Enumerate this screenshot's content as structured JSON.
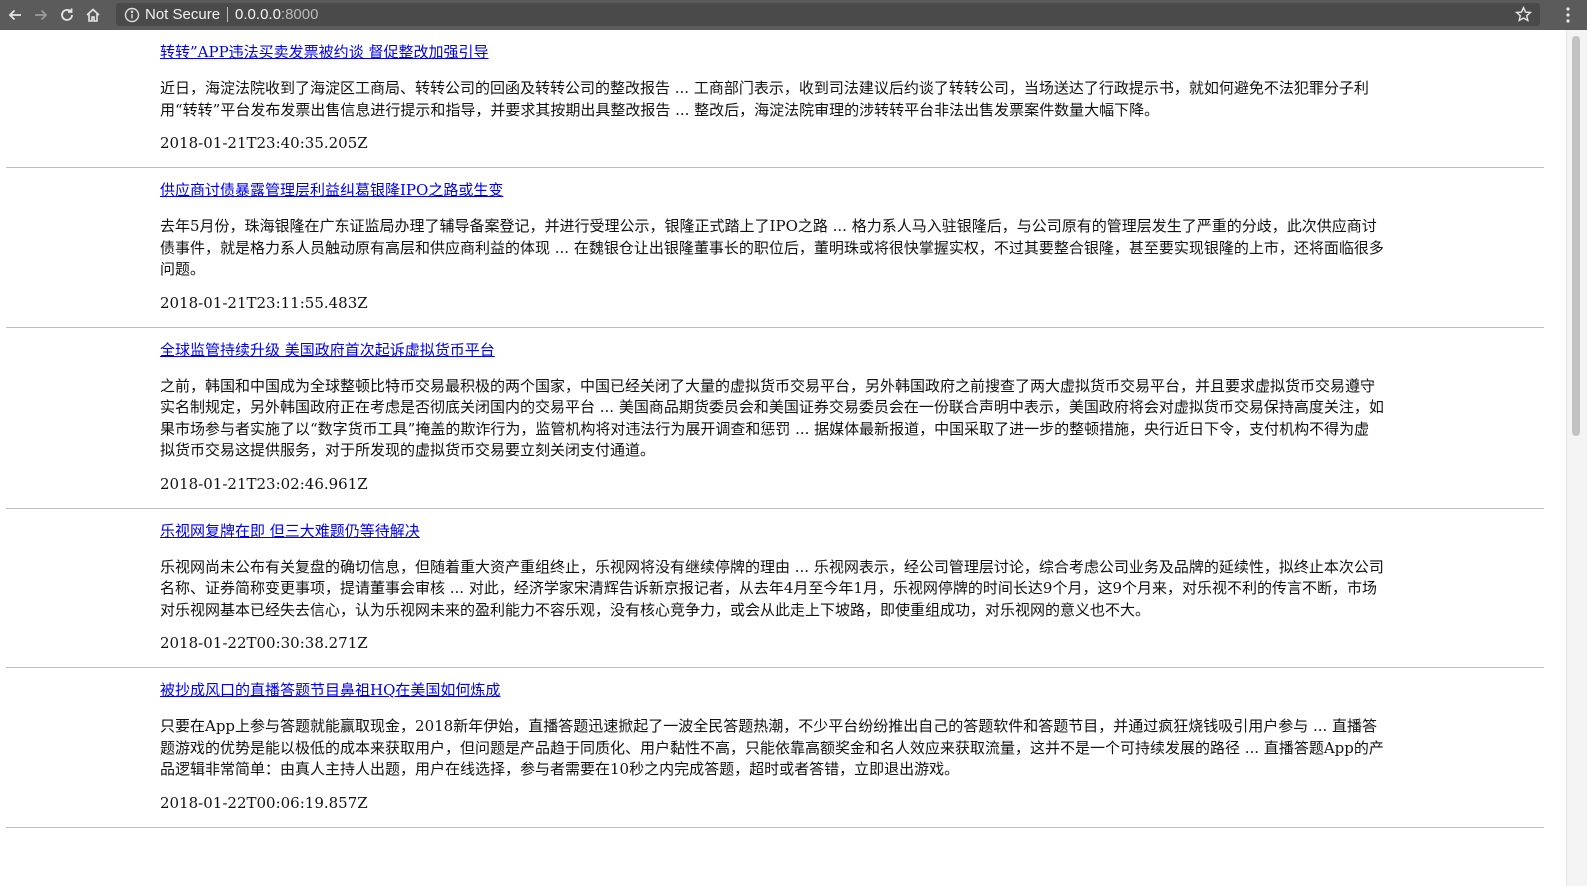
{
  "browser": {
    "security_label": "Not Secure",
    "url_host": "0.0.0.0",
    "url_port": ":8000",
    "icons": {
      "back": "back-arrow-icon",
      "forward": "forward-arrow-icon",
      "reload": "reload-icon",
      "home": "home-icon",
      "info": "info-icon",
      "star": "star-icon",
      "menu": "kebab-menu-icon"
    }
  },
  "articles": [
    {
      "title": "转转”APP违法买卖发票被约谈 督促整改加强引导",
      "summary": "近日，海淀法院收到了海淀区工商局、转转公司的回函及转转公司的整改报告 ... 工商部门表示，收到司法建议后约谈了转转公司，当场送达了行政提示书，就如何避免不法犯罪分子利用“转转”平台发布发票出售信息进行提示和指导，并要求其按期出具整改报告 ... 整改后，海淀法院审理的涉转转平台非法出售发票案件数量大幅下降。",
      "date": "2018-01-21T23:40:35.205Z"
    },
    {
      "title": "供应商讨债暴露管理层利益纠葛银隆IPO之路或生变",
      "summary": "去年5月份，珠海银隆在广东证监局办理了辅导备案登记，并进行受理公示，银隆正式踏上了IPO之路 ... 格力系人马入驻银隆后，与公司原有的管理层发生了严重的分歧，此次供应商讨债事件，就是格力系人员触动原有高层和供应商利益的体现 ... 在魏银仓让出银隆董事长的职位后，董明珠或将很快掌握实权，不过其要整合银隆，甚至要实现银隆的上市，还将面临很多问题。",
      "date": "2018-01-21T23:11:55.483Z"
    },
    {
      "title": "全球监管持续升级 美国政府首次起诉虚拟货币平台",
      "summary": "之前，韩国和中国成为全球整顿比特币交易最积极的两个国家，中国已经关闭了大量的虚拟货币交易平台，另外韩国政府之前搜查了两大虚拟货币交易平台，并且要求虚拟货币交易遵守实名制规定，另外韩国政府正在考虑是否彻底关闭国内的交易平台 ... 美国商品期货委员会和美国证券交易委员会在一份联合声明中表示，美国政府将会对虚拟货币交易保持高度关注，如果市场参与者实施了以“数字货币工具”掩盖的欺诈行为，监管机构将对违法行为展开调查和惩罚 ... 据媒体最新报道，中国采取了进一步的整顿措施，央行近日下令，支付机构不得为虚拟货币交易这提供服务，对于所发现的虚拟货币交易要立刻关闭支付通道。",
      "date": "2018-01-21T23:02:46.961Z"
    },
    {
      "title": "乐视网复牌在即 但三大难题仍等待解决",
      "summary": "乐视网尚未公布有关复盘的确切信息，但随着重大资产重组终止，乐视网将没有继续停牌的理由 ... 乐视网表示，经公司管理层讨论，综合考虑公司业务及品牌的延续性，拟终止本次公司名称、证券简称变更事项，提请董事会审核 ... 对此，经济学家宋清辉告诉新京报记者，从去年4月至今年1月，乐视网停牌的时间长达9个月，这9个月来，对乐视不利的传言不断，市场对乐视网基本已经失去信心，认为乐视网未来的盈利能力不容乐观，没有核心竞争力，或会从此走上下坡路，即使重组成功，对乐视网的意义也不大。",
      "date": "2018-01-22T00:30:38.271Z"
    },
    {
      "title": "被抄成风口的直播答题节目鼻祖HQ在美国如何炼成",
      "summary": "只要在App上参与答题就能赢取现金，2018新年伊始，直播答题迅速掀起了一波全民答题热潮，不少平台纷纷推出自己的答题软件和答题节目，并通过疯狂烧钱吸引用户参与 ... 直播答题游戏的优势是能以极低的成本来获取用户，但问题是产品趋于同质化、用户黏性不高，只能依靠高额奖金和名人效应来获取流量，这并不是一个可持续发展的路径 ... 直播答题App的产品逻辑非常简单：由真人主持人出题，用户在线选择，参与者需要在10秒之内完成答题，超时或者答错，立即退出游戏。",
      "date": "2018-01-22T00:06:19.857Z"
    }
  ]
}
